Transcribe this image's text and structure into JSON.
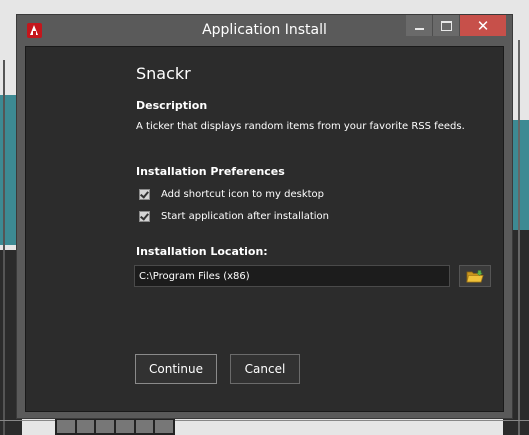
{
  "window": {
    "title": "Application Install",
    "controls": {
      "minimize": "minimize",
      "maximize": "maximize",
      "close": "✕"
    },
    "icon": "adobe-air-icon"
  },
  "app": {
    "name": "Snackr"
  },
  "description": {
    "heading": "Description",
    "text": "A ticker that displays random items from your favorite RSS feeds."
  },
  "preferences": {
    "heading": "Installation Preferences",
    "options": [
      {
        "label": "Add shortcut icon to my desktop",
        "checked": true
      },
      {
        "label": "Start application after installation",
        "checked": true
      }
    ]
  },
  "location": {
    "heading": "Installation Location:",
    "value": "C:\\Program Files (x86)",
    "browse_icon": "folder-icon"
  },
  "buttons": {
    "continue": "Continue",
    "cancel": "Cancel"
  },
  "colors": {
    "close_button": "#c7504a",
    "content_bg": "#2c2c2c",
    "frame_bg": "#5a5a5a",
    "icon_red": "#c4161c",
    "folder_yellow": "#f0c23a"
  }
}
